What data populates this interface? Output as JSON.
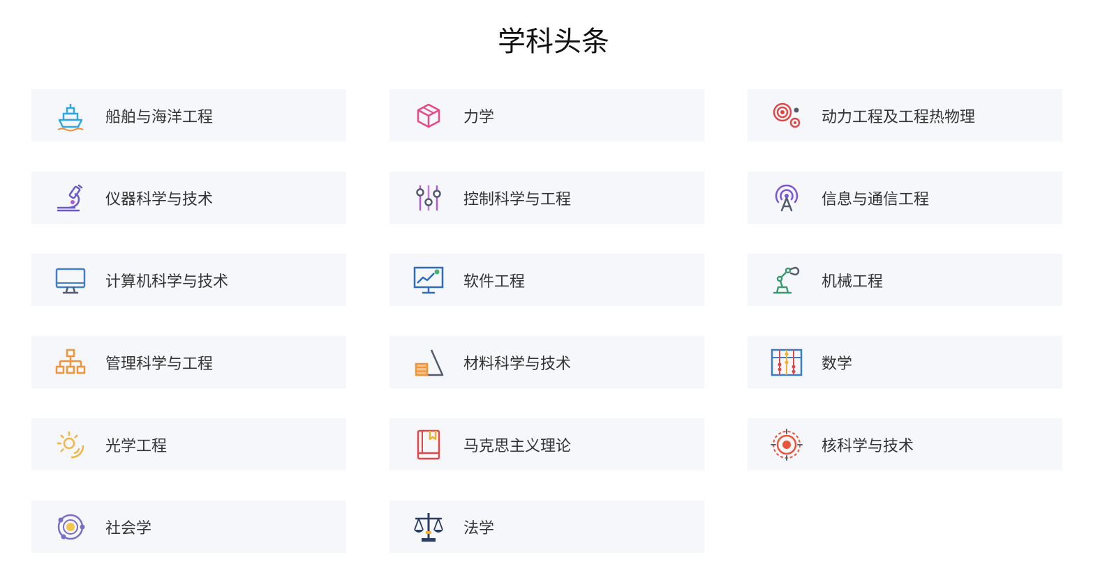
{
  "page": {
    "title": "学科头条"
  },
  "subjects": [
    {
      "label": "船舶与海洋工程",
      "icon": "ship-icon",
      "color": "#2fa7e0"
    },
    {
      "label": "力学",
      "icon": "cube-icon",
      "color": "#e8478a"
    },
    {
      "label": "动力工程及工程热物理",
      "icon": "target-icon",
      "color": "#e04848"
    },
    {
      "label": "仪器科学与技术",
      "icon": "microscope-icon",
      "color": "#6a5acd"
    },
    {
      "label": "控制科学与工程",
      "icon": "sliders-icon",
      "color": "#b05ad8"
    },
    {
      "label": "信息与通信工程",
      "icon": "antenna-icon",
      "color": "#7b55d8"
    },
    {
      "label": "计算机科学与技术",
      "icon": "monitor-icon",
      "color": "#3f7fc8"
    },
    {
      "label": "软件工程",
      "icon": "chart-board-icon",
      "color": "#2f6bbd"
    },
    {
      "label": "机械工程",
      "icon": "robot-arm-icon",
      "color": "#3d9a6e"
    },
    {
      "label": "管理科学与工程",
      "icon": "org-chart-icon",
      "color": "#f0953a"
    },
    {
      "label": "材料科学与技术",
      "icon": "materials-icon",
      "color": "#f0953a"
    },
    {
      "label": "数学",
      "icon": "abacus-icon",
      "color": "#3a7ec8"
    },
    {
      "label": "光学工程",
      "icon": "sun-rays-icon",
      "color": "#f4b548"
    },
    {
      "label": "马克思主义理论",
      "icon": "book-icon",
      "color": "#e04848"
    },
    {
      "label": "核科学与技术",
      "icon": "nuclear-target-icon",
      "color": "#e8553a"
    },
    {
      "label": "社会学",
      "icon": "orbit-icon",
      "color": "#7b6cc8"
    },
    {
      "label": "法学",
      "icon": "scales-icon",
      "color": "#2c3e63"
    }
  ]
}
